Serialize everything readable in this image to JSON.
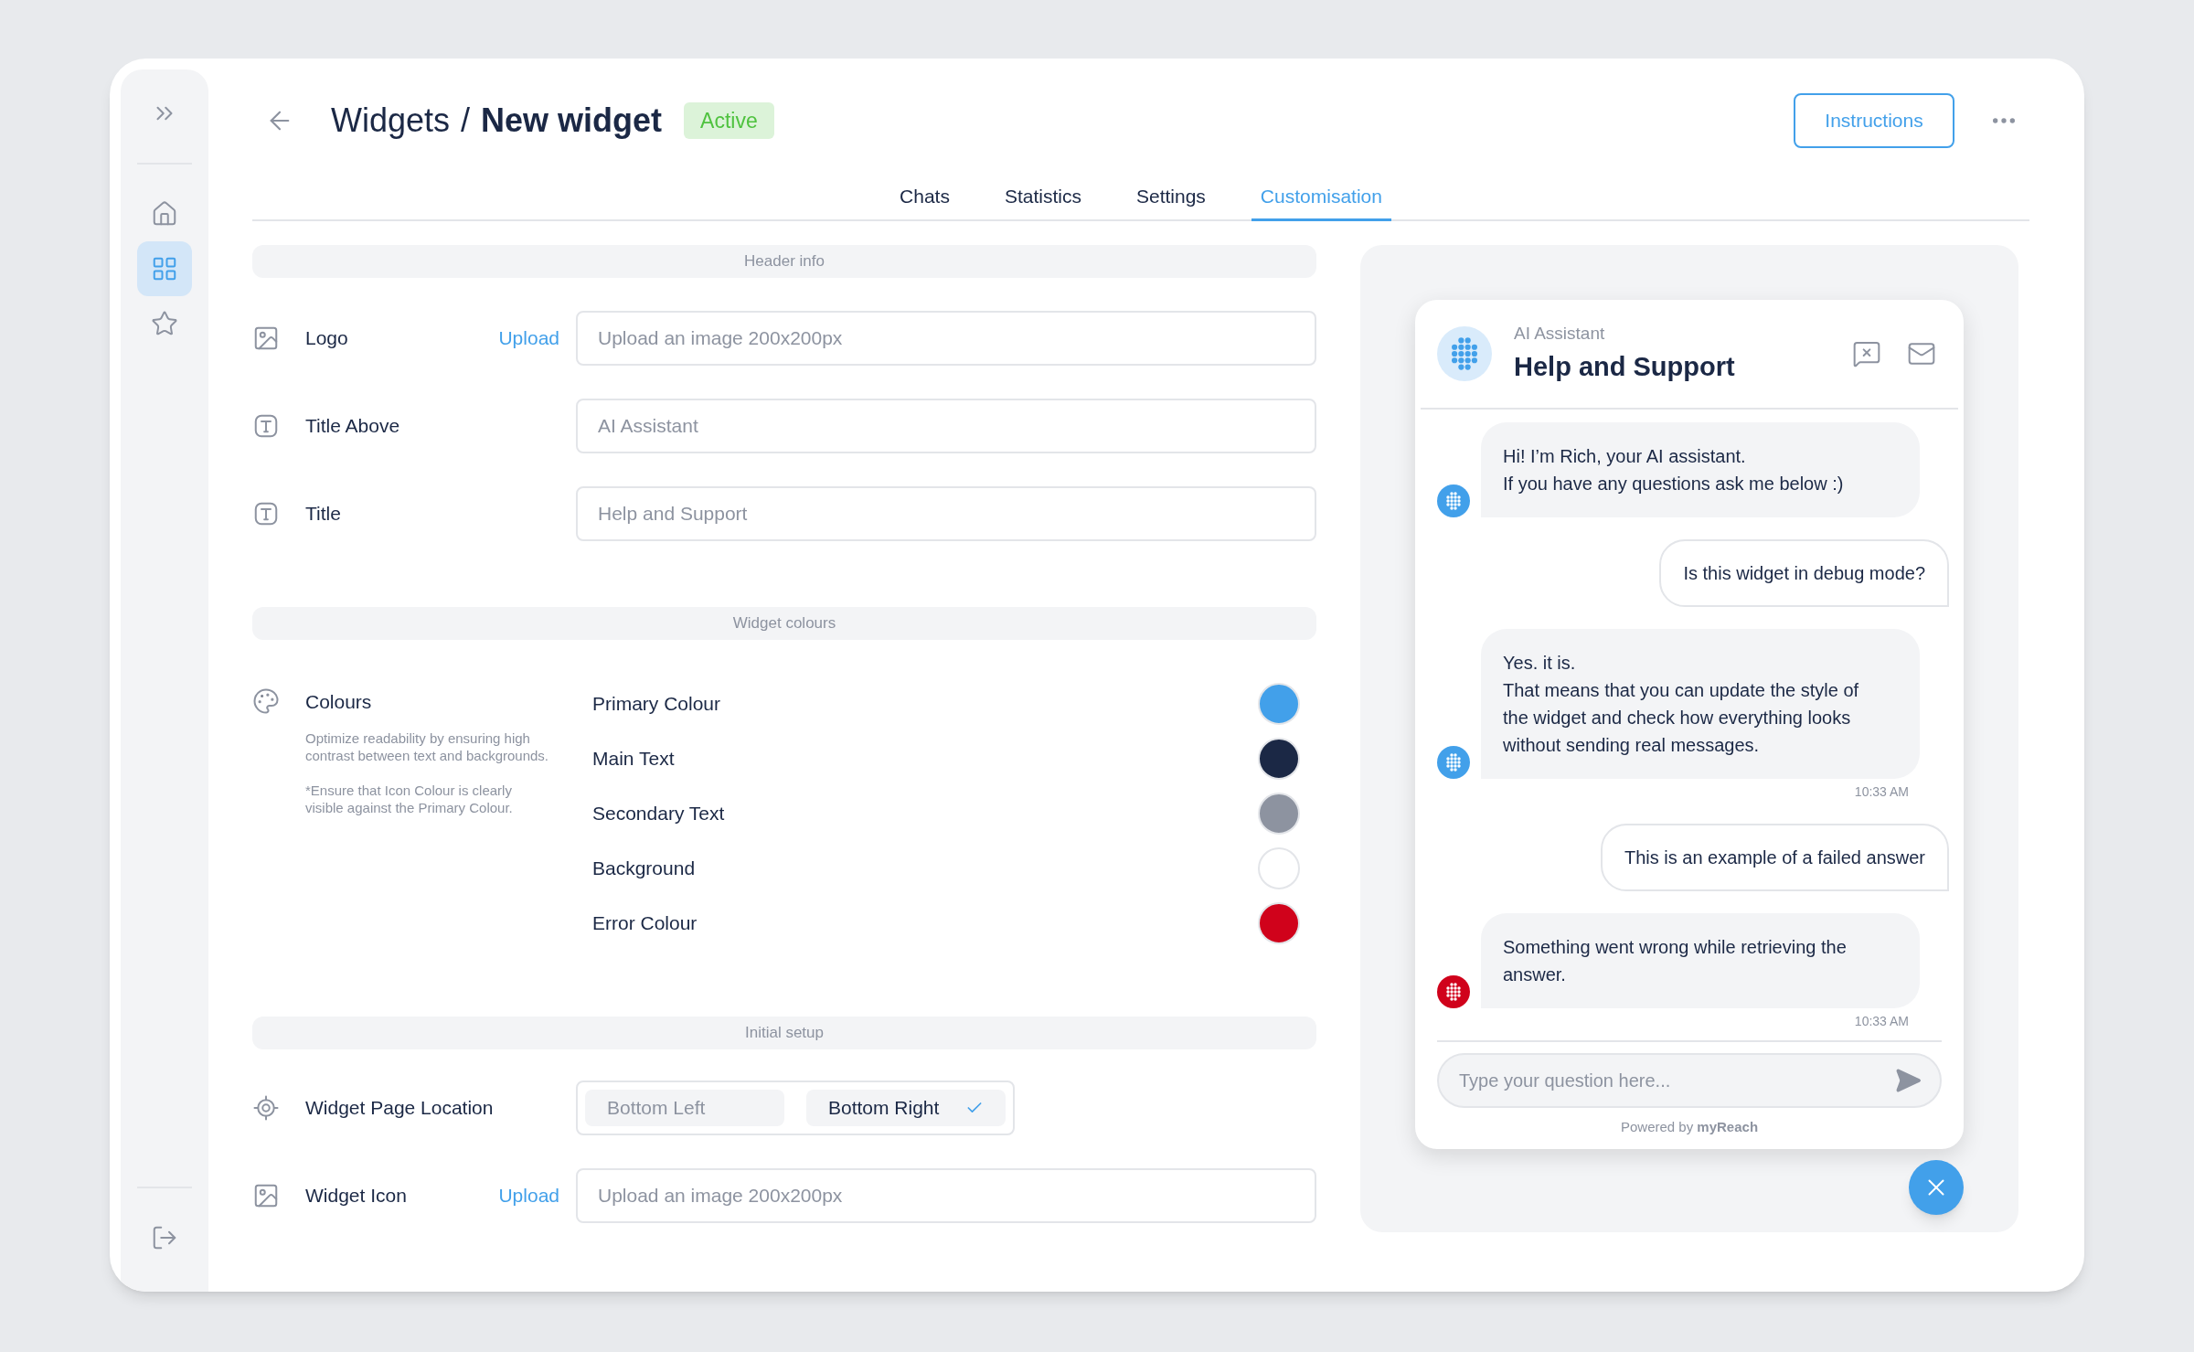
{
  "sidebar": {
    "items": [
      {
        "kind": "expand",
        "selected": false
      },
      {
        "kind": "home",
        "selected": false
      },
      {
        "kind": "widgets",
        "selected": true
      },
      {
        "kind": "favorites",
        "selected": false
      },
      {
        "kind": "logout",
        "selected": false
      }
    ]
  },
  "header": {
    "breadcrumb": "Widgets",
    "separator": "/",
    "title": "New widget",
    "status": "Active",
    "instructions_button": "Instructions"
  },
  "tabs": [
    {
      "label": "Chats",
      "selected": false
    },
    {
      "label": "Statistics",
      "selected": false
    },
    {
      "label": "Settings",
      "selected": false
    },
    {
      "label": "Customisation",
      "selected": true
    }
  ],
  "sections": [
    {
      "title": "Header info",
      "rows": [
        {
          "kind": "upload",
          "label": "Logo",
          "action": "Upload",
          "placeholder": "Upload an image 200x200px"
        },
        {
          "kind": "text",
          "label": "Title Above",
          "placeholder": "AI Assistant"
        },
        {
          "kind": "text",
          "label": "Title",
          "placeholder": "Help and Support"
        }
      ]
    },
    {
      "title": "Widget colours",
      "rows": [
        {
          "kind": "colours",
          "label": "Colours",
          "description": "Optimize readability by ensuring high contrast between text and backgrounds.",
          "note": "*Ensure that Icon Colour is clearly visible against the Primary Colour.",
          "colours": [
            {
              "name": "Primary Colour",
              "color": "#42a0ea"
            },
            {
              "name": "Main Text",
              "color": "#1b2845"
            },
            {
              "name": "Secondary Text",
              "color": "#8d93a0"
            },
            {
              "name": "Background",
              "color": "#ffffff"
            },
            {
              "name": "Error Colour",
              "color": "#d0021b"
            }
          ]
        }
      ]
    },
    {
      "title": "Initial setup",
      "rows": [
        {
          "kind": "location",
          "label": "Widget Page Location",
          "options": [
            {
              "label": "Bottom Left",
              "selected": false
            },
            {
              "label": "Bottom Right",
              "selected": true
            }
          ]
        },
        {
          "kind": "upload",
          "label": "Widget Icon",
          "action": "Upload",
          "placeholder": "Upload an image 200x200px"
        }
      ]
    }
  ],
  "preview": {
    "title_above": "AI Assistant",
    "title": "Help and Support",
    "messages": [
      {
        "kind": "bot",
        "error": false,
        "text": "Hi! I’m Rich, your AI assistant.\nIf you have any questions ask me below :)"
      },
      {
        "kind": "user",
        "text": "Is this widget in debug mode?"
      },
      {
        "kind": "bot",
        "error": false,
        "text": "Yes. it is.\nThat means that you can update the style of the widget and check how everything looks without sending real messages.",
        "time": "10:33 AM"
      },
      {
        "kind": "user",
        "text": "This is an example of a failed answer"
      },
      {
        "kind": "bot",
        "error": true,
        "text": "Something went wrong while retrieving the answer.",
        "time": "10:33 AM"
      }
    ],
    "input_placeholder": "Type your question here...",
    "powered_by": "Powered by **myReach**"
  }
}
